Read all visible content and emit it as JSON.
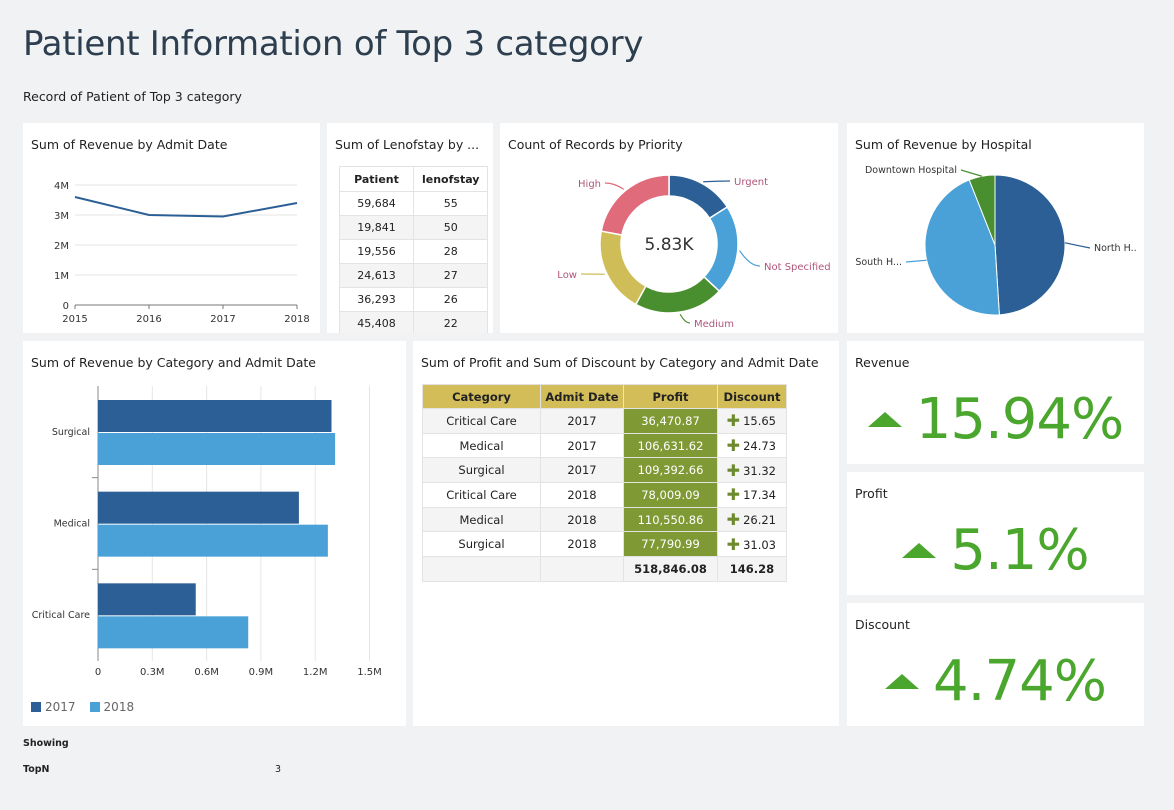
{
  "page": {
    "title": "Patient Information of Top 3 category",
    "subtitle": "Record of Patient of Top 3 category"
  },
  "colors": {
    "dark_blue": "#2b5f95",
    "light_blue": "#4aa1d8",
    "green": "#4aa62c",
    "olive": "#7f9a35",
    "gold": "#d3bd59"
  },
  "revenue_by_date": {
    "title": "Sum of Revenue by Admit Date",
    "chart_data": {
      "type": "line",
      "x": [
        "2015",
        "2016",
        "2017",
        "2018"
      ],
      "series": [
        {
          "values": [
            3600000,
            3000000,
            2950000,
            3400000
          ]
        }
      ],
      "yticks": [
        "4M",
        "3M",
        "2M",
        "1M",
        "0"
      ],
      "ylim": [
        0,
        4000000
      ]
    }
  },
  "lenofstay": {
    "title": "Sum of Lenofstay by ...",
    "columns": [
      "Patient",
      "lenofstay"
    ],
    "rows": [
      [
        "59,684",
        "55"
      ],
      [
        "19,841",
        "50"
      ],
      [
        "19,556",
        "28"
      ],
      [
        "24,613",
        "27"
      ],
      [
        "36,293",
        "26"
      ],
      [
        "45,408",
        "22"
      ]
    ]
  },
  "priority": {
    "title": "Count of Records by Priority",
    "center_label": "5.83K",
    "chart_data": {
      "type": "pie",
      "labels": [
        "Urgent",
        "Not Specified",
        "Medium",
        "Low",
        "High"
      ],
      "values": [
        16,
        21,
        21,
        20,
        22
      ],
      "colors": [
        "#2b5f95",
        "#4aa1d8",
        "#4a8f2f",
        "#cfbd57",
        "#e06b7a"
      ]
    }
  },
  "hospital": {
    "title": "Sum of Revenue by Hospital",
    "chart_data": {
      "type": "pie",
      "labels": [
        "North H..",
        "South H...",
        "Downtown Hospital"
      ],
      "values": [
        49,
        45,
        6
      ],
      "colors": [
        "#2b5f95",
        "#4aa1d8",
        "#4a8f2f"
      ]
    }
  },
  "category_revenue": {
    "title": "Sum of Revenue by Category and Admit Date",
    "chart_data": {
      "type": "bar",
      "orientation": "horizontal",
      "categories": [
        "Surgical",
        "Medical",
        "Critical Care"
      ],
      "series": [
        {
          "name": "2017",
          "values": [
            1290000,
            1110000,
            540000
          ],
          "color": "#2b5f95"
        },
        {
          "name": "2018",
          "values": [
            1310000,
            1270000,
            830000
          ],
          "color": "#4aa1d8"
        }
      ],
      "xticks": [
        "0",
        "0.3M",
        "0.6M",
        "0.9M",
        "1.2M",
        "1.5M"
      ],
      "xlim": [
        0,
        1500000
      ]
    }
  },
  "profit_discount": {
    "title": "Sum of Profit and Sum of Discount by Category and Admit Date",
    "columns": [
      "Category",
      "Admit Date",
      "Profit",
      "Discount"
    ],
    "rows": [
      [
        "Critical Care",
        "2017",
        "36,470.87",
        "15.65"
      ],
      [
        "Medical",
        "2017",
        "106,631.62",
        "24.73"
      ],
      [
        "Surgical",
        "2017",
        "109,392.66",
        "31.32"
      ],
      [
        "Critical Care",
        "2018",
        "78,009.09",
        "17.34"
      ],
      [
        "Medical",
        "2018",
        "110,550.86",
        "26.21"
      ],
      [
        "Surgical",
        "2018",
        "77,790.99",
        "31.03"
      ]
    ],
    "totals": [
      "",
      "",
      "518,846.08",
      "146.28"
    ]
  },
  "kpis": {
    "revenue": {
      "label": "Revenue",
      "value": "15.94%"
    },
    "profit": {
      "label": "Profit",
      "value": "5.1%"
    },
    "discount": {
      "label": "Discount",
      "value": "4.74%"
    }
  },
  "footer": {
    "showing_label": "Showing",
    "topn_label": "TopN",
    "topn_value": "3"
  }
}
